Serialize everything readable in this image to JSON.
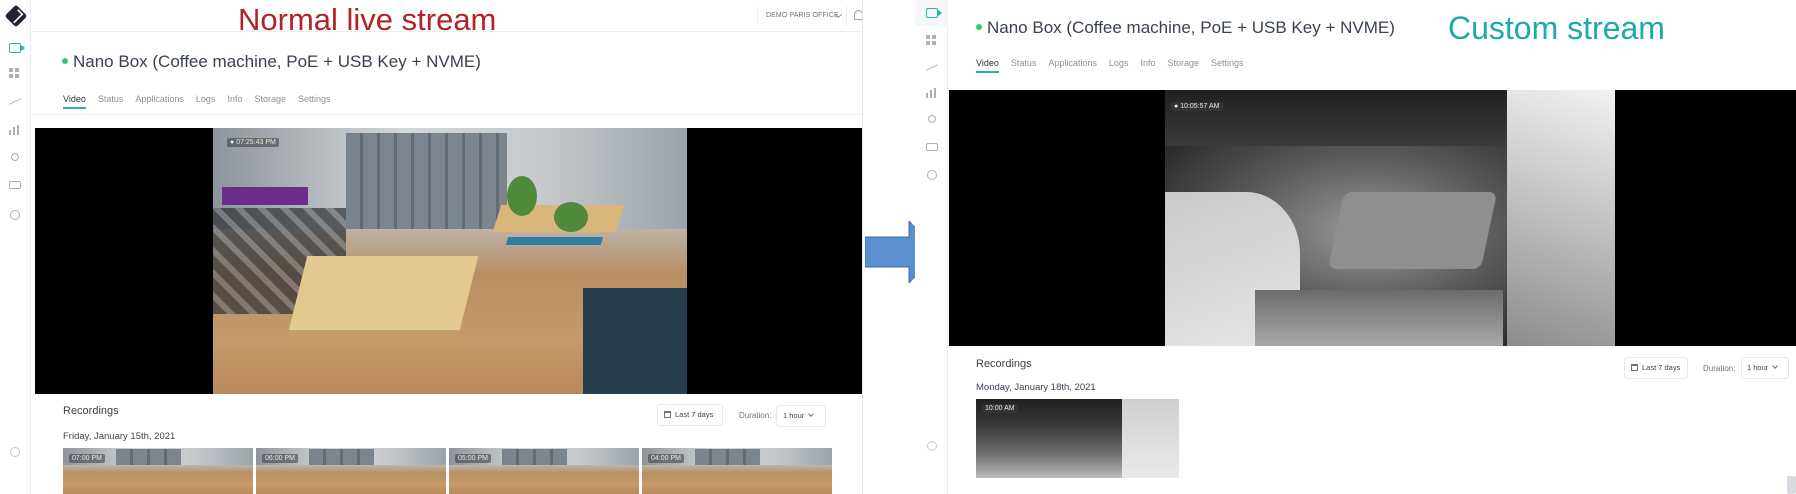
{
  "left": {
    "banner": "Normal live stream",
    "org_select": "DEMO PARIS OFFICE",
    "device": {
      "name": "Nano Box (Coffee machine, PoE + USB Key + NVME)",
      "status_color": "#2ecc71"
    },
    "tabs": [
      {
        "label": "Video",
        "active": true
      },
      {
        "label": "Status",
        "active": false
      },
      {
        "label": "Applications",
        "active": false
      },
      {
        "label": "Logs",
        "active": false
      },
      {
        "label": "Info",
        "active": false
      },
      {
        "label": "Storage",
        "active": false
      },
      {
        "label": "Settings",
        "active": false
      }
    ],
    "live_timestamp": "07:25:43 PM",
    "recordings": {
      "heading": "Recordings",
      "range": "Last 7 days",
      "duration_label": "Duration:",
      "duration_value": "1 hour",
      "date": "Friday, January 15th, 2021",
      "thumbnails": [
        "07:00 PM",
        "06:00 PM",
        "05:00 PM",
        "04:00 PM"
      ]
    }
  },
  "right": {
    "banner": "Custom stream",
    "device": {
      "name": "Nano Box (Coffee machine, PoE + USB Key + NVME)",
      "status_color": "#2ecc71"
    },
    "tabs": [
      {
        "label": "Video",
        "active": true
      },
      {
        "label": "Status",
        "active": false
      },
      {
        "label": "Applications",
        "active": false
      },
      {
        "label": "Logs",
        "active": false
      },
      {
        "label": "Info",
        "active": false
      },
      {
        "label": "Storage",
        "active": false
      },
      {
        "label": "Settings",
        "active": false
      }
    ],
    "live_timestamp": "10:05:57 AM",
    "recordings": {
      "heading": "Recordings",
      "range": "Last 7 days",
      "duration_label": "Duration:",
      "duration_value": "1 hour",
      "date": "Monday, January 18th, 2021",
      "thumbnails": [
        "10:00 AM"
      ]
    }
  },
  "colors": {
    "accent": "#2ab3a7",
    "banner_left": "#b22328",
    "banner_right": "#1fa9a9",
    "arrow": "#5b8fcf"
  },
  "icons": [
    "logo-icon",
    "video-icon",
    "grid-icon",
    "trend-icon",
    "bar-chart-icon",
    "key-icon",
    "chat-icon",
    "team-icon",
    "help-icon",
    "bell-icon",
    "user-icon",
    "calendar-icon",
    "chevron-down-icon"
  ]
}
